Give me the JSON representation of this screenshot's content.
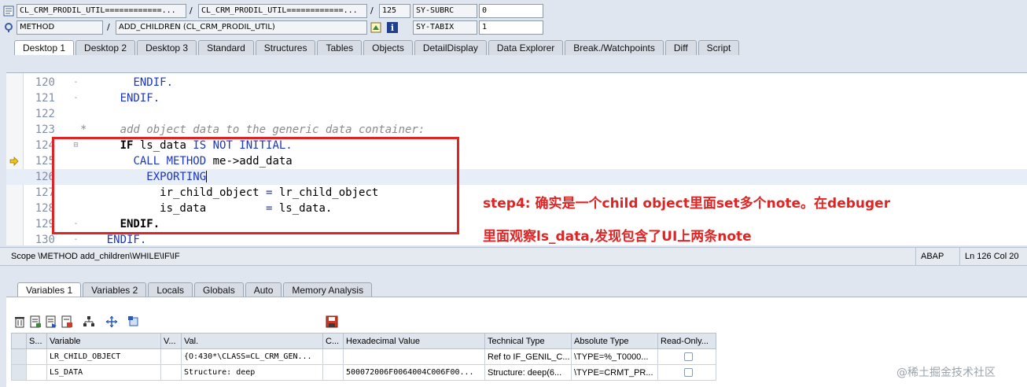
{
  "header": {
    "row1": {
      "program": "CL_CRM_PRODIL_UTIL============...",
      "include": "CL_CRM_PRODIL_UTIL============...",
      "line": "125",
      "sysvar": "SY-SUBRC",
      "sysval": "0",
      "separator": "/"
    },
    "row2": {
      "event_type": "METHOD",
      "event": "ADD_CHILDREN (CL_CRM_PRODIL_UTIL)",
      "sysvar": "SY-TABIX",
      "sysval": "1",
      "separator": "/"
    }
  },
  "desktop_tabs": [
    "Desktop 1",
    "Desktop 2",
    "Desktop 3",
    "Standard",
    "Structures",
    "Tables",
    "Objects",
    "DetailDisplay",
    "Data Explorer",
    "Break./Watchpoints",
    "Diff",
    "Script"
  ],
  "code_lines": [
    {
      "num": "120",
      "fold": "-",
      "parts": [
        {
          "t": "        ",
          "c": "tx"
        },
        {
          "t": "ENDIF.",
          "c": "kw"
        }
      ]
    },
    {
      "num": "121",
      "fold": "-",
      "parts": [
        {
          "t": "      ",
          "c": "tx"
        },
        {
          "t": "ENDIF.",
          "c": "kw"
        }
      ]
    },
    {
      "num": "122",
      "fold": "",
      "parts": []
    },
    {
      "num": "123",
      "fold": "",
      "parts": [
        {
          "t": "*     add object data to the generic data container:",
          "c": "cm"
        }
      ]
    },
    {
      "num": "124",
      "fold": "⊟",
      "parts": [
        {
          "t": "      ",
          "c": "tx"
        },
        {
          "t": "IF",
          "c": "kwb"
        },
        {
          "t": " ls_data ",
          "c": "tx"
        },
        {
          "t": "IS NOT INITIAL.",
          "c": "kw"
        }
      ]
    },
    {
      "num": "125",
      "fold": "",
      "parts": [
        {
          "t": "        ",
          "c": "tx"
        },
        {
          "t": "CALL METHOD",
          "c": "kw"
        },
        {
          "t": " me->add_data",
          "c": "tx"
        }
      ]
    },
    {
      "num": "126",
      "fold": "",
      "parts": [
        {
          "t": "          ",
          "c": "tx"
        },
        {
          "t": "EXPORTING",
          "c": "kw"
        }
      ]
    },
    {
      "num": "127",
      "fold": "",
      "parts": [
        {
          "t": "            ir_child_object ",
          "c": "tx"
        },
        {
          "t": "=",
          "c": "kw"
        },
        {
          "t": " lr_child_object",
          "c": "tx"
        }
      ]
    },
    {
      "num": "128",
      "fold": "",
      "parts": [
        {
          "t": "            is_data         ",
          "c": "tx"
        },
        {
          "t": "=",
          "c": "kw"
        },
        {
          "t": " ls_data.",
          "c": "tx"
        }
      ]
    },
    {
      "num": "129",
      "fold": "-",
      "parts": [
        {
          "t": "      ",
          "c": "tx"
        },
        {
          "t": "ENDIF.",
          "c": "kwb"
        }
      ]
    },
    {
      "num": "130",
      "fold": "-",
      "parts": [
        {
          "t": "    ",
          "c": "tx"
        },
        {
          "t": "ENDIF.",
          "c": "kw"
        }
      ]
    }
  ],
  "current_line": "125",
  "highlight_line": "126",
  "annotation": {
    "line1": "step4: 确实是一个child object里面set多个note。在debuger",
    "line2": "里面观察ls_data,发现包含了UI上两条note"
  },
  "scope_bar": {
    "scope": "Scope \\METHOD add_children\\WHILE\\IF\\IF",
    "language": "ABAP",
    "position": "Ln 126 Col  20"
  },
  "var_tabs": [
    "Variables 1",
    "Variables 2",
    "Locals",
    "Globals",
    "Auto",
    "Memory Analysis"
  ],
  "grid": {
    "columns": [
      "S...",
      "Variable",
      "V...",
      "Val.",
      "C...",
      "Hexadecimal Value",
      "Technical Type",
      "Absolute Type",
      "Read-Only..."
    ],
    "rows": [
      [
        "",
        "LR_CHILD_OBJECT",
        "",
        "{O:430*\\CLASS=CL_CRM_GEN...",
        "",
        "",
        "Ref to IF_GENIL_C...",
        "\\TYPE=%_T0000...",
        ""
      ],
      [
        "",
        "LS_DATA",
        "",
        "Structure: deep",
        "",
        "500072006F0064004C006F00...",
        "Structure: deep(6...",
        "\\TYPE=CRMT_PR...",
        ""
      ]
    ]
  },
  "watermark": "@稀土掘金技术社区"
}
